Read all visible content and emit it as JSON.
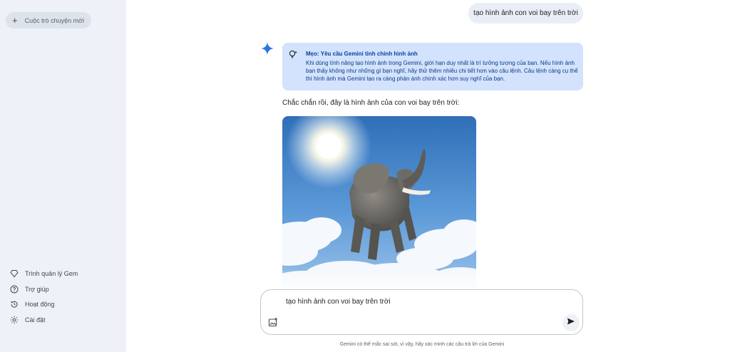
{
  "sidebar": {
    "new_chat_label": "Cuộc trò chuyện mới",
    "items": [
      {
        "label": "Trình quản lý Gem",
        "icon": "gem-icon"
      },
      {
        "label": "Trợ giúp",
        "icon": "help-icon"
      },
      {
        "label": "Hoạt động",
        "icon": "history-icon"
      },
      {
        "label": "Cài đặt",
        "icon": "gear-icon"
      }
    ]
  },
  "conversation": {
    "user_message": "tạo hình ảnh con voi bay trên trời",
    "tip_title": "Mẹo: Yêu cầu Gemini tinh chỉnh hình ảnh",
    "tip_body": "Khi dùng tính năng tạo hình ảnh trong Gemini, giới hạn duy nhất là trí tưởng tượng của bạn. Nếu hình ảnh bạn thấy không như những gì bạn nghĩ, hãy thử thêm nhiều chi tiết hơn vào câu lệnh. Câu lệnh càng cụ thể thì hình ảnh mà Gemini tạo ra càng phản ánh chính xác hơn suy nghĩ của bạn.",
    "response_text": "Chắc chắn rồi, đây là hình ảnh của con voi bay trên trời:",
    "image_subject": "elephant flying in blue sky with sun and clouds"
  },
  "input": {
    "value": "tạo hình ảnh con voi bay trên trời"
  },
  "footer": {
    "disclaimer": "Gemini có thể mắc sai sót, vì vậy, hãy xác minh các câu trả lời của Gemini"
  },
  "colors": {
    "sidebar_bg": "#eef2f8",
    "tip_bg": "#d3e3fd",
    "accent_blue": "#1a73e8"
  }
}
